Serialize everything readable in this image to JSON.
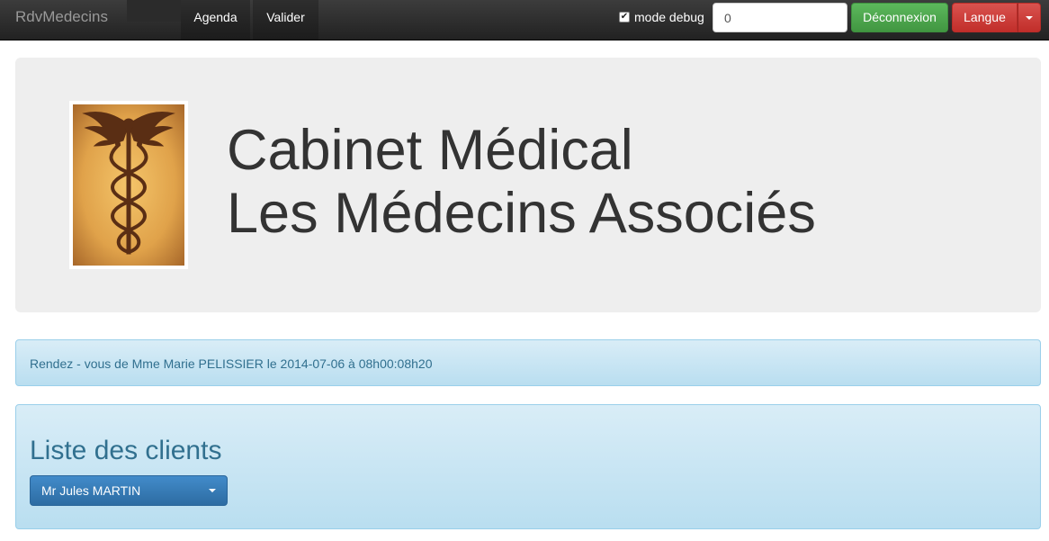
{
  "navbar": {
    "brand": "RdvMedecins",
    "links": [
      {
        "label": "Agenda"
      },
      {
        "label": "Valider"
      }
    ],
    "debug": {
      "label": "mode debug",
      "checked": true,
      "check_glyph": "✔"
    },
    "time_input": {
      "value": "0"
    },
    "logout_label": "Déconnexion",
    "language_label": "Langue"
  },
  "jumbotron": {
    "logo_icon": "caduceus-icon",
    "title_line1": "Cabinet Médical",
    "title_line2": "Les Médecins Associés"
  },
  "alert": {
    "text": "Rendez - vous de Mme Marie PELISSIER le 2014-07-06 à 08h00:08h20"
  },
  "clients": {
    "title": "Liste des clients",
    "selected": "Mr Jules MARTIN"
  },
  "colors": {
    "navbar": "#222222",
    "success": "#5cb85c",
    "danger": "#d9534f",
    "info_bg": "#d9edf7",
    "info_text": "#31708f",
    "primary": "#428bca",
    "jumbotron": "#eeeeee"
  }
}
